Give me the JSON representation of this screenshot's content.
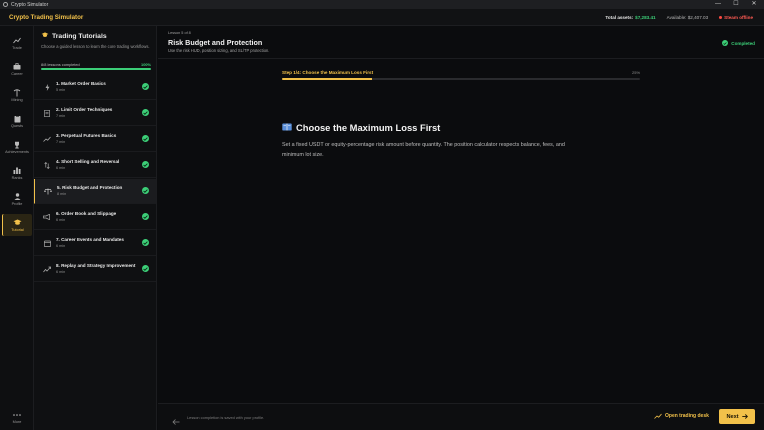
{
  "window": {
    "title": "Crypto Simulator",
    "controls": [
      "—",
      "☐",
      "✕"
    ]
  },
  "header": {
    "brand": "Crypto Trading Simulator",
    "total_assets_label": "Total assets:",
    "total_assets_value": "$7,283.41",
    "available": "Available: $2,407.03",
    "status": "Steam offline"
  },
  "nav": {
    "items": [
      {
        "label": "Trade",
        "icon": "chart-line-icon"
      },
      {
        "label": "Career",
        "icon": "briefcase-icon"
      },
      {
        "label": "Mining",
        "icon": "pickaxe-icon"
      },
      {
        "label": "Quests",
        "icon": "clipboard-icon"
      },
      {
        "label": "Achievements",
        "icon": "trophy-icon"
      },
      {
        "label": "Ranks",
        "icon": "bar-chart-icon"
      },
      {
        "label": "Profile",
        "icon": "user-icon"
      },
      {
        "label": "Tutorial",
        "icon": "graduation-cap-icon"
      },
      {
        "label": "More",
        "icon": "more-dots-icon"
      }
    ],
    "active": "Tutorial"
  },
  "lessons_panel": {
    "title": "Trading Tutorials",
    "subtitle": "Choose a guided lesson to learn the core trading workflows.",
    "progress_text": "8/8 lessons completed",
    "progress_pct": "100%",
    "progress_value": 100,
    "lessons": [
      {
        "title": "1. Market Order Basics",
        "time": "5 min",
        "icon": "bolt-icon",
        "done": true
      },
      {
        "title": "2. Limit Order Techniques",
        "time": "7 min",
        "icon": "order-book-icon",
        "done": true
      },
      {
        "title": "3. Perpetual Futures Basics",
        "time": "7 min",
        "icon": "trend-up-icon",
        "done": true
      },
      {
        "title": "4. Short Selling and Reversal",
        "time": "6 min",
        "icon": "arrows-updown-icon",
        "done": true
      },
      {
        "title": "5. Risk Budget and Protection",
        "time": "8 min",
        "icon": "scale-icon",
        "done": true
      },
      {
        "title": "6. Order Book and Slippage",
        "time": "6 min",
        "icon": "megaphone-icon",
        "done": true
      },
      {
        "title": "7. Career Events and Mandates",
        "time": "6 min",
        "icon": "calendar-icon",
        "done": true
      },
      {
        "title": "8. Replay and Strategy Improvement",
        "time": "6 min",
        "icon": "replay-chart-icon",
        "done": true
      }
    ],
    "active_index": 4
  },
  "main": {
    "lesson_number": "Lesson 5 of 8",
    "lesson_title": "Risk Budget and Protection",
    "lesson_desc": "Use the risk HUD, position sizing, and SL/TP protection.",
    "status": "Completed",
    "step_label": "Step 1/4: Choose the Maximum Loss First",
    "step_pct": "25%",
    "step_progress": 25,
    "step_heading": "Choose the Maximum Loss First",
    "step_body": "Set a fixed USDT or equity-percentage risk amount before quantity. The position calculator respects balance, fees, and minimum lot size."
  },
  "footer": {
    "note": "Lesson completion is saved with your profile.",
    "open_desk": "Open trading desk",
    "next": "Next"
  },
  "colors": {
    "accent": "#f2c14a",
    "success": "#3ccf78",
    "danger": "#ff4a42",
    "background": "#0b0c0e"
  }
}
